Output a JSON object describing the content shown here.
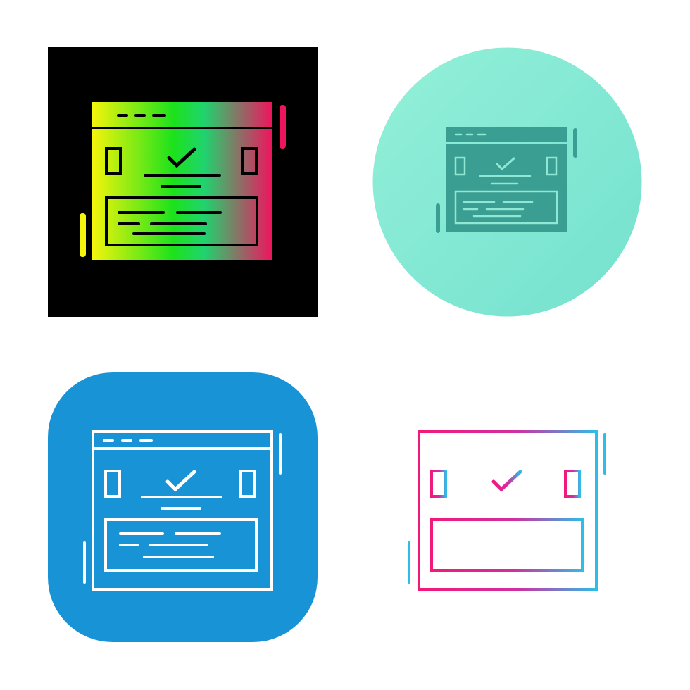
{
  "icon_set": {
    "icon_name": "webpage-approved-icon",
    "variants": [
      {
        "style": "gradient-glyph",
        "background_shape": "square",
        "background_color": "#000000",
        "gradient_colors": [
          "#f4f40c",
          "#1ce21c",
          "#18e07a",
          "#f0135e"
        ]
      },
      {
        "style": "glyph",
        "background_shape": "circle",
        "background_color": "#8eecd6",
        "glyph_color": "#3a9e92"
      },
      {
        "style": "line",
        "background_shape": "rounded-square",
        "background_color": "#1893d6",
        "stroke_color": "#ffffff"
      },
      {
        "style": "gradient-line",
        "background_shape": "none",
        "background_color": "#ffffff",
        "gradient_colors": [
          "#f2197a",
          "#2dbde6"
        ]
      }
    ]
  }
}
